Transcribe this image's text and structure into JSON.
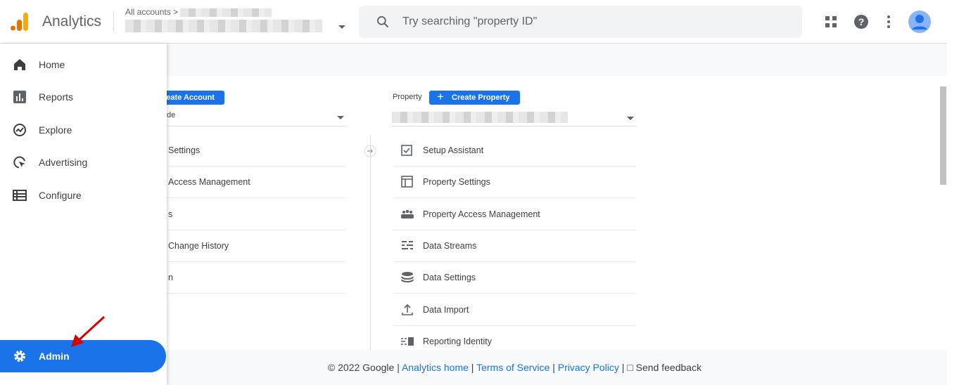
{
  "header": {
    "brand": "Analytics",
    "breadcrumb": "All accounts >",
    "search_placeholder": "Try searching \"property ID\""
  },
  "sidebar": {
    "items": [
      {
        "label": "Home",
        "icon": "home-icon"
      },
      {
        "label": "Reports",
        "icon": "bar-chart-icon"
      },
      {
        "label": "Explore",
        "icon": "explore-icon"
      },
      {
        "label": "Advertising",
        "icon": "advertising-icon"
      },
      {
        "label": "Configure",
        "icon": "list-icon"
      }
    ],
    "admin": "Admin"
  },
  "account": {
    "create_label": "reate Account",
    "selected": "de",
    "items": [
      "Settings",
      "Access Management",
      "s",
      "Change History",
      "n"
    ]
  },
  "property": {
    "label": "Property",
    "create_label": "Create Property",
    "items": [
      "Setup Assistant",
      "Property Settings",
      "Property Access Management",
      "Data Streams",
      "Data Settings",
      "Data Import",
      "Reporting Identity"
    ]
  },
  "footer": {
    "copyright": "© 2022 Google |",
    "analytics_home": "Analytics home",
    "sep1": "|",
    "terms": "Terms of Service",
    "sep2": "|",
    "privacy": "Privacy Policy",
    "sep3": "|",
    "feedback": "Send feedback"
  },
  "colors": {
    "accent": "#1a73e8",
    "arrow": "#d50000"
  }
}
